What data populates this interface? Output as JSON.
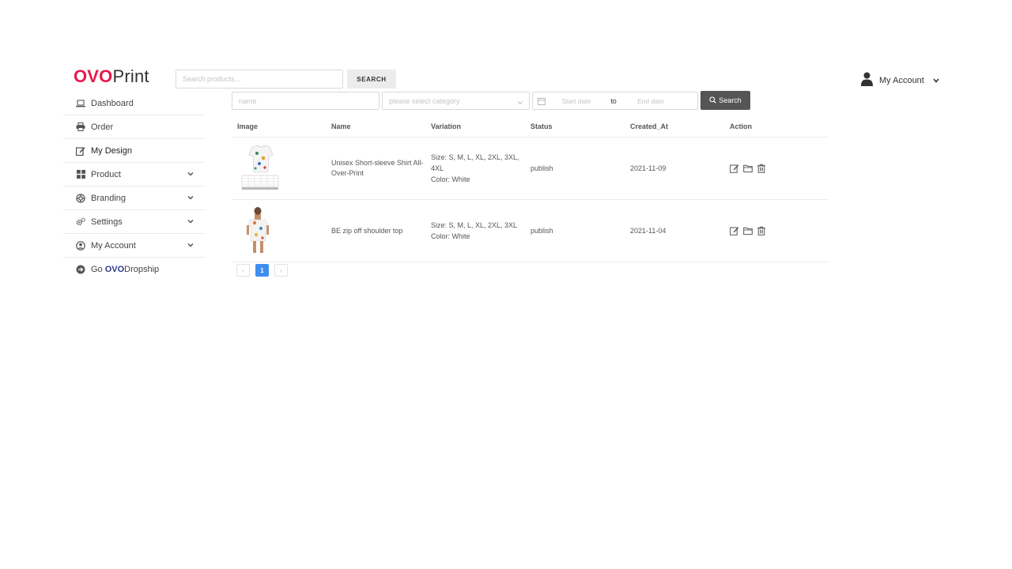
{
  "header": {
    "logo_brand": "OVO",
    "logo_suffix": "Print",
    "search_placeholder": "Search products...",
    "search_button": "SEARCH",
    "account_label": "My Account"
  },
  "sidebar": {
    "items": [
      {
        "label": "Dashboard",
        "icon": "laptop-icon"
      },
      {
        "label": "Order",
        "icon": "printer-icon"
      },
      {
        "label": "My Design",
        "icon": "edit-icon"
      },
      {
        "label": "Product",
        "icon": "grid-icon"
      },
      {
        "label": "Branding",
        "icon": "lifebuoy-icon"
      },
      {
        "label": "Settings",
        "icon": "cogs-icon"
      },
      {
        "label": "My Account",
        "icon": "user-circle-icon"
      }
    ],
    "go": {
      "prefix": "Go",
      "brand": "OVO",
      "suffix": "Dropship",
      "icon": "arrow-circle-icon"
    }
  },
  "filters": {
    "name_placeholder": "name",
    "category_placeholder": "please select category",
    "start_placeholder": "Start date",
    "to_label": "to",
    "end_placeholder": "End date",
    "search_button": "Search"
  },
  "table": {
    "columns": [
      "Image",
      "Name",
      "Variation",
      "Status",
      "Created_At",
      "Action"
    ],
    "rows": [
      {
        "name": "Unisex Short-sleeve Shirt All-Over-Print",
        "size": "Size: S, M, L, XL, 2XL, 3XL, 4XL",
        "color": "Color: White",
        "status": "publish",
        "created_at": "2021-11-09"
      },
      {
        "name": "BE zip off shoulder top",
        "size": "Size: S, M, L, XL, 2XL, 3XL",
        "color": "Color: White",
        "status": "publish",
        "created_at": "2021-11-04"
      }
    ]
  },
  "pagination": {
    "prev": "‹",
    "current": "1",
    "next": "›"
  },
  "colors": {
    "brand": "#e8194c",
    "dropship_brand": "#2d3a8c",
    "active_page": "#3d8ef0",
    "search_button_bg": "#555555"
  }
}
